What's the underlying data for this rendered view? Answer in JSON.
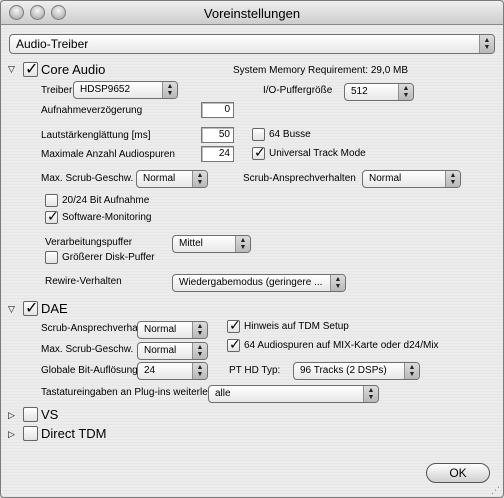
{
  "window": {
    "title": "Voreinstellungen"
  },
  "top_popup": {
    "value": "Audio-Treiber"
  },
  "core_audio": {
    "label": "Core Audio",
    "checked": true,
    "memory_requirement": "System Memory Requirement: 29,0 MB",
    "driver_label": "Treiber",
    "driver_value": "HDSP9652",
    "io_buffer_label": "I/O-Puffergröße",
    "io_buffer_value": "512",
    "recording_delay_label": "Aufnahmeverzögerung",
    "recording_delay_value": "0",
    "volume_smoothing_label": "Lautstärkenglättung [ms]",
    "volume_smoothing_value": "50",
    "max_tracks_label": "Maximale Anzahl Audiospuren",
    "max_tracks_value": "24",
    "busses_label": "64 Busse",
    "busses_checked": false,
    "utm_label": "Universal Track Mode",
    "utm_checked": true,
    "scrub_speed_label": "Max. Scrub-Geschw.",
    "scrub_speed_value": "Normal",
    "scrub_response_label": "Scrub-Ansprechverhalten",
    "scrub_response_value": "Normal",
    "bit2024_label": "20/24 Bit Aufnahme",
    "bit2024_checked": false,
    "software_monitoring_label": "Software-Monitoring",
    "software_monitoring_checked": true,
    "processing_buffer_label": "Verarbeitungspuffer",
    "processing_buffer_value": "Mittel",
    "bigger_disk_buffer_label": "Größerer Disk-Puffer",
    "bigger_disk_buffer_checked": false,
    "rewire_label": "Rewire-Verhalten",
    "rewire_value": "Wiedergabemodus (geringere ..."
  },
  "dae": {
    "label": "DAE",
    "checked": true,
    "scrub_response_label": "Scrub-Ansprechverha",
    "scrub_response_value": "Normal",
    "scrub_speed_label": "Max. Scrub-Geschw.",
    "scrub_speed_value": "Normal",
    "bit_resolution_label": "Globale Bit-Auflösung",
    "bit_resolution_value": "24",
    "tdm_hint_label": "Hinweis auf TDM Setup",
    "tdm_hint_checked": true,
    "mix_tracks_label": "64 Audiospuren auf MIX-Karte oder d24/Mix",
    "mix_tracks_checked": true,
    "pt_hd_type_label": "PT HD Typ:",
    "pt_hd_type_value": "96 Tracks (2 DSPs)",
    "keyboard_input_label": "Tastatureingaben an Plug-ins weiterlei",
    "keyboard_input_value": "alle"
  },
  "vs": {
    "label": "VS",
    "checked": false
  },
  "direct_tdm": {
    "label": "Direct TDM",
    "checked": false
  },
  "ok_button": {
    "label": "OK"
  },
  "icons": {
    "popup_arrows": "▲▼",
    "disclosure_open": "▽",
    "disclosure_closed": "▷"
  }
}
